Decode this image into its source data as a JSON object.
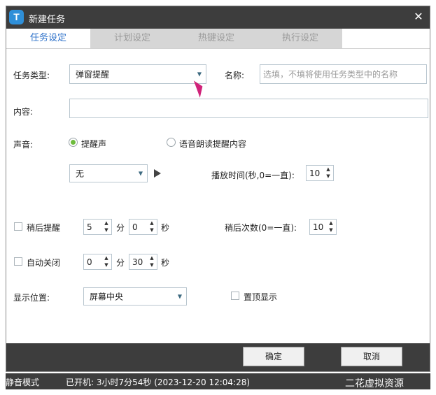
{
  "window": {
    "title": "新建任务",
    "close_glyph": "✕",
    "app_logo_letter": "T"
  },
  "tabs": [
    {
      "label": "任务设定",
      "active": true
    },
    {
      "label": "计划设定",
      "active": false
    },
    {
      "label": "热键设定",
      "active": false
    },
    {
      "label": "执行设定",
      "active": false
    }
  ],
  "form": {
    "task_type": {
      "label": "任务类型:",
      "value": "弹窗提醒"
    },
    "name": {
      "label": "名称:",
      "placeholder": "选填，不填将使用任务类型中的名称"
    },
    "content": {
      "label": "内容:",
      "value": ""
    },
    "sound": {
      "label": "声音:",
      "options": [
        {
          "label": "提醒声",
          "checked": true
        },
        {
          "label": "语音朗读提醒内容",
          "checked": false
        }
      ],
      "sound_select": "无",
      "play_time": {
        "label": "播放时间(秒,0=一直):",
        "value": "10"
      }
    },
    "snooze": {
      "label": "稍后提醒",
      "checked": false,
      "minutes": "5",
      "seconds": "0",
      "min_unit": "分",
      "sec_unit": "秒",
      "count": {
        "label": "稍后次数(0=一直):",
        "value": "10"
      }
    },
    "auto_close": {
      "label": "自动关闭",
      "checked": false,
      "minutes": "0",
      "seconds": "30",
      "min_unit": "分",
      "sec_unit": "秒"
    },
    "position": {
      "label": "显示位置:",
      "value": "屏幕中央"
    },
    "topmost": {
      "label": "置顶显示",
      "checked": false
    }
  },
  "footer": {
    "ok_label": "确定",
    "cancel_label": "取消"
  },
  "statusbar": {
    "mode": "静音模式",
    "uptime": "已开机: 3小时7分54秒 (2023-12-20 12:04:28)"
  },
  "watermark": "二花虚拟资源",
  "icons": {
    "dropdown": "▼",
    "spin_up": "▲",
    "spin_down": "▼"
  },
  "colors": {
    "titlebar": "#3d3d3d",
    "active_tab": "#2a6fc9",
    "radio_checked": "#6dbb3c",
    "cursor": "#d0237a"
  }
}
